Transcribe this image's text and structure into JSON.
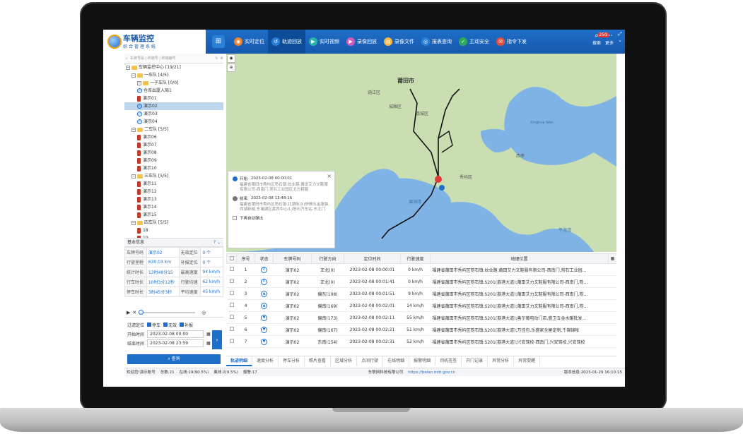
{
  "app": {
    "title_line1": "车辆监控",
    "title_line2": "综合管理系统"
  },
  "nav": [
    {
      "label": "实时定位",
      "color": "#f0832a",
      "icon": "◉"
    },
    {
      "label": "轨迹回放",
      "color": "#2b80d8",
      "icon": "↺"
    },
    {
      "label": "实时视频",
      "color": "#29b6a6",
      "icon": "▶"
    },
    {
      "label": "录像回放",
      "color": "#d35bb8",
      "icon": "▶"
    },
    {
      "label": "录像文件",
      "color": "#f5b83a",
      "icon": "▤"
    },
    {
      "label": "报表查询",
      "color": "#2b80d8",
      "icon": "◎"
    },
    {
      "label": "主动安全",
      "color": "#2eaa5b",
      "icon": "✓"
    },
    {
      "label": "指令下发",
      "color": "#e54d3c",
      "icon": "✉"
    }
  ],
  "topright": {
    "search_label": "搜索",
    "more_label": "更多",
    "badge": "250"
  },
  "search": {
    "placeholder": "车牌号码 | 终端号 | 终端编号"
  },
  "tree": [
    {
      "label": "车辆监控中心 [19/21]",
      "type": "folder",
      "level": 0
    },
    {
      "label": "一车队 [4/5]",
      "type": "folder",
      "level": 1
    },
    {
      "label": "一子车队 [0/0]",
      "type": "folder",
      "level": 2
    },
    {
      "label": "仓库出厦入局1",
      "type": "circle",
      "level": 2
    },
    {
      "label": "演示01",
      "type": "car",
      "level": 2
    },
    {
      "label": "演示02",
      "type": "circle",
      "level": 2,
      "selected": true
    },
    {
      "label": "演示03",
      "type": "circle",
      "level": 2
    },
    {
      "label": "演示04",
      "type": "circle",
      "level": 2
    },
    {
      "label": "二车队 [5/5]",
      "type": "folder",
      "level": 1
    },
    {
      "label": "演示06",
      "type": "car",
      "level": 2
    },
    {
      "label": "演示07",
      "type": "car",
      "level": 2
    },
    {
      "label": "演示08",
      "type": "car",
      "level": 2
    },
    {
      "label": "演示09",
      "type": "car",
      "level": 2
    },
    {
      "label": "演示10",
      "type": "car",
      "level": 2
    },
    {
      "label": "三车队 [5/5]",
      "type": "folder",
      "level": 1
    },
    {
      "label": "演示11",
      "type": "car",
      "level": 2
    },
    {
      "label": "演示12",
      "type": "car",
      "level": 2
    },
    {
      "label": "演示13",
      "type": "car",
      "level": 2
    },
    {
      "label": "演示14",
      "type": "car",
      "level": 2
    },
    {
      "label": "演示15",
      "type": "car",
      "level": 2
    },
    {
      "label": "四车队 [5/5]",
      "type": "folder",
      "level": 1
    },
    {
      "label": "18",
      "type": "car",
      "level": 2
    },
    {
      "label": "19",
      "type": "car",
      "level": 2
    }
  ],
  "info": {
    "title": "基本信息",
    "rows": [
      [
        "车牌号码",
        "演示02",
        "无效定位",
        "0 个"
      ],
      [
        "行驶里程",
        "630.03 km",
        "补报定位",
        "0 个"
      ],
      [
        "统计时长",
        "13时48分15",
        "最高速度",
        "94 km/h"
      ],
      [
        "行车时长",
        "10时3分12秒",
        "行驶均速",
        "62 km/h"
      ],
      [
        "停车时长",
        "3时45分3秒",
        "平均速度",
        "45 km/h"
      ]
    ]
  },
  "filter": {
    "label": "过滤定位",
    "opt1": "停车",
    "opt2": "无效",
    "opt3": "补报",
    "start_label": "开始时间",
    "start_value": "2023-02-08  00:00",
    "end_label": "结束时间",
    "end_value": "2023-02-08  23:59",
    "query_label": "查询"
  },
  "popup": {
    "start_label": "开始:",
    "start_time": "2023-02-08 00:00:01",
    "start_addr": "福建省莆田市秀屿区笏石镇:纹业路;莆田艾力文鞋服有限公司-西南门,笏石工业园区北方鞋服",
    "end_label": "结束:",
    "end_time": "2023-02-08 13:48:16",
    "end_addr": "福建省莆田市秀屿区笏石镇:北潮街(X)伊雅五金服装,西湖新城,东埔湖区黄西中心(L)笏石汽车站-东北门",
    "checkbox": "下再自动弹出"
  },
  "map_labels": [
    {
      "t": "莆田市"
    },
    {
      "t": "涵江区"
    },
    {
      "t": "城厢区"
    },
    {
      "t": "荔城区"
    },
    {
      "t": "秀屿区"
    },
    {
      "t": "Xinghua Wan"
    },
    {
      "t": "湄洲湾"
    },
    {
      "t": "平海湾"
    },
    {
      "t": "西亭"
    }
  ],
  "table": {
    "headers": [
      "序号",
      "状态",
      "车牌号码",
      "行驶方向",
      "定位时间",
      "行驶速度",
      "地理位置"
    ],
    "rows": [
      [
        "1",
        "P",
        "演示02",
        "正北(0)",
        "2023-02-08 00:00:01",
        "0 km/h",
        "福建省莆田市秀屿区笏石镇:纹业路;莆田艾力文鞋服有限公司-西南门,笏石工业园..."
      ],
      [
        "2",
        "P",
        "演示02",
        "正北(0)",
        "2023-02-08 00:01:41",
        "0 km/h",
        "福建省莆田市秀屿区笏石镇:S201(荔港大道);莆田艾力文鞋服有限公司-西南门,笏..."
      ],
      [
        "3",
        "▲",
        "演示02",
        "偏东(108)",
        "2023-02-08 00:01:51",
        "9 km/h",
        "福建省莆田市秀屿区笏石镇:S201(荔港大道);莆田艾力文鞋服有限公司-西南门,笏..."
      ],
      [
        "4",
        "▲",
        "演示02",
        "偏南(169)",
        "2023-02-08 00:02:01",
        "14 km/h",
        "福建省莆田市秀屿区笏石镇:S201(荔港大道);莆田艾力文鞋服有限公司-西南门,笏..."
      ],
      [
        "5",
        "▼",
        "演示02",
        "偏南(173)",
        "2023-02-08 00:02:11",
        "55 km/h",
        "福建省莆田市秀屿区笏石镇:S201(荔港大道);善尔葡电动门店,盛卫五金水暖批发..."
      ],
      [
        "6",
        "▼",
        "演示02",
        "偏南(167)",
        "2023-02-08 00:02:21",
        "51 km/h",
        "福建省莆田市秀屿区笏石镇:S201(荔港大道);万佳包,乐盛家全屋定制,千锦锦帐"
      ],
      [
        "7",
        "▼",
        "演示02",
        "东南(154)",
        "2023-02-08 00:02:31",
        "52 km/h",
        "福建省莆田市秀屿区笏石镇:S201(荔港大道);兴安驾校-西南门,兴安驾校,兴安驾校"
      ]
    ]
  },
  "tabs": [
    "轨迹明细",
    "速度分析",
    "停车分析",
    "照片查看",
    "区域分析",
    "点间行驶",
    "在线明细",
    "报警明细",
    "司机签签",
    "开门记录",
    "异常分析",
    "异常提醒"
  ],
  "status": {
    "welcome": "欢迎您!演示账号",
    "total": "总数:21",
    "online": "在线:19(90.5%)",
    "offline": "离线:2(9.5%)",
    "alarm": "报警:17",
    "company": "车联网科技有限公司",
    "site": "https://beian.miit.gov.cn",
    "version": "版本信息:2023-01-29 16:10:15"
  },
  "colors": {
    "primary": "#1f6fc9",
    "map_water": "#7fb3e6",
    "map_land": "#c9dfb1"
  }
}
